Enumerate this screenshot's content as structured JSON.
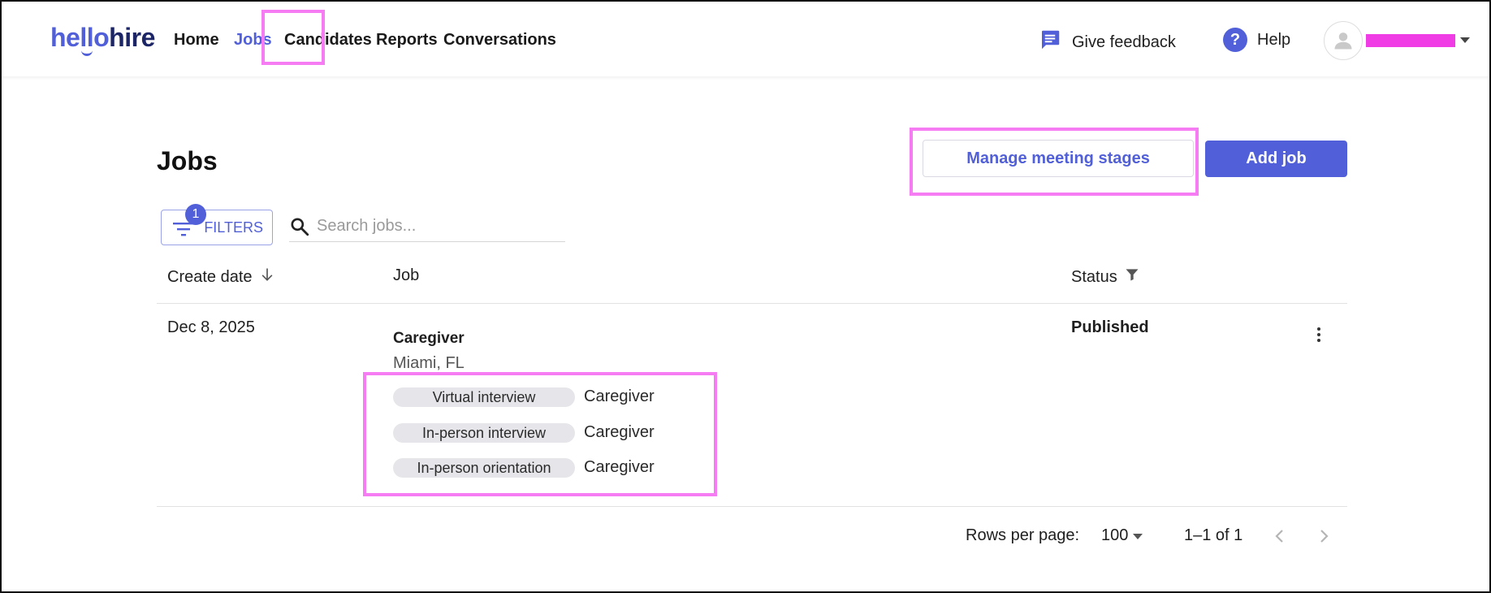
{
  "header": {
    "logo_hello": "hello",
    "logo_hire": "hire",
    "nav": [
      {
        "label": "Home"
      },
      {
        "label": "Jobs"
      },
      {
        "label": "Candidates"
      },
      {
        "label": "Reports"
      },
      {
        "label": "Conversations"
      }
    ],
    "active_nav": "Jobs",
    "feedback_label": "Give feedback",
    "help_label": "Help",
    "help_glyph": "?"
  },
  "page": {
    "title": "Jobs",
    "manage_button": "Manage meeting stages",
    "add_button": "Add job",
    "filters_label": "FILTERS",
    "filters_count": "1",
    "search_placeholder": "Search jobs..."
  },
  "table": {
    "columns": [
      "Create date",
      "Job",
      "Status"
    ],
    "rows": [
      {
        "create_date": "Dec 8, 2025",
        "job_title": "Caregiver",
        "location": "Miami, FL",
        "stages": [
          {
            "stage": "Virtual interview",
            "role": "Caregiver"
          },
          {
            "stage": "In-person interview",
            "role": "Caregiver"
          },
          {
            "stage": "In-person orientation",
            "role": "Caregiver"
          }
        ],
        "status": "Published"
      }
    ]
  },
  "pagination": {
    "rows_per_page_label": "Rows per page:",
    "rows_per_page_value": "100",
    "range": "1–1 of 1"
  },
  "colors": {
    "accent": "#5160d8",
    "highlight": "#f57cf2",
    "chip_bg": "#e6e6ea"
  },
  "icons": [
    "feedback-icon",
    "help-icon",
    "user-avatar-icon",
    "filter-icon",
    "search-icon",
    "sort-arrow-down-icon",
    "funnel-icon",
    "more-vert-icon",
    "chevron-left-icon",
    "chevron-right-icon"
  ]
}
